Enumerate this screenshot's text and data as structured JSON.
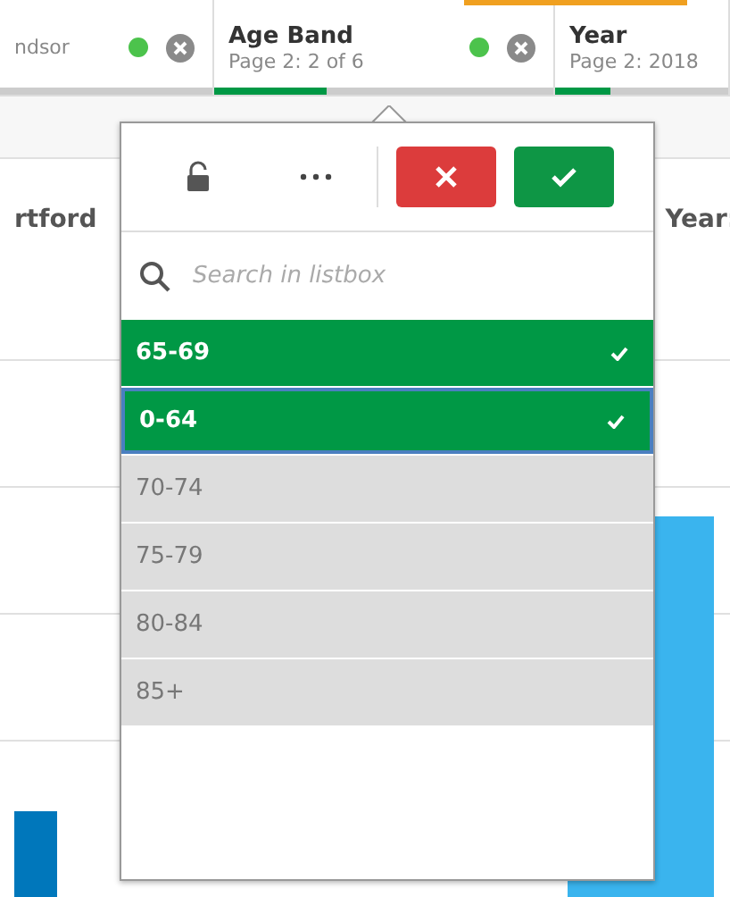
{
  "selections": [
    {
      "subtitle": "ndsor"
    },
    {
      "title": "Age Band",
      "subtitle": "Page 2: 2 of 6",
      "level": 0.33
    },
    {
      "title": "Year",
      "subtitle": "Page 2: 2018",
      "level": 0.32
    }
  ],
  "background": {
    "left_title": "rtford",
    "right_title": "Year:"
  },
  "listbox": {
    "search": {
      "placeholder": "Search in listbox"
    },
    "items": [
      {
        "label": "65-69",
        "selected": true,
        "focused": false
      },
      {
        "label": "0-64",
        "selected": true,
        "focused": true
      },
      {
        "label": "70-74",
        "selected": false,
        "focused": false
      },
      {
        "label": "75-79",
        "selected": false,
        "focused": false
      },
      {
        "label": "80-84",
        "selected": false,
        "focused": false
      },
      {
        "label": "85+",
        "selected": false,
        "focused": false
      }
    ]
  }
}
